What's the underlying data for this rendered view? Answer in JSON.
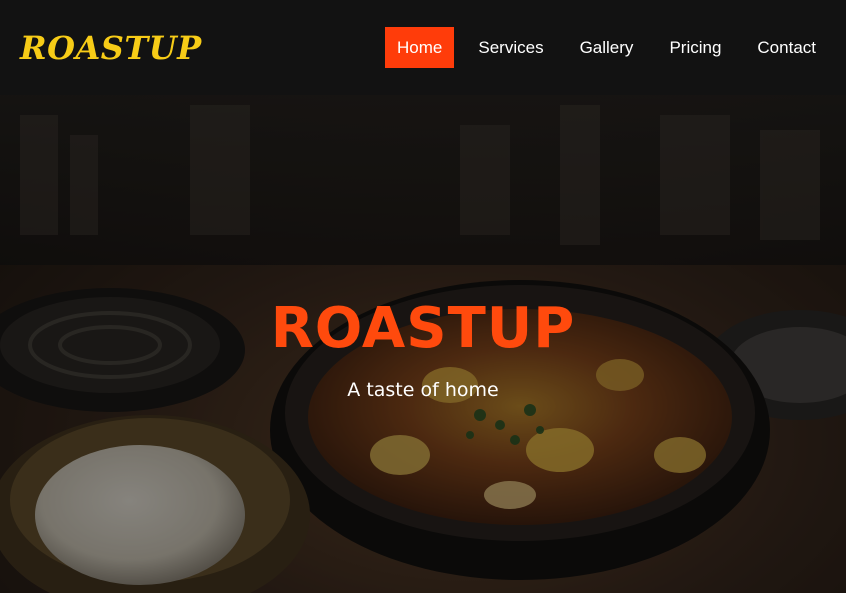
{
  "brand": {
    "logo_text": "ROASTUP",
    "logo_color": "#f7cc17"
  },
  "nav": {
    "items": [
      {
        "label": "Home",
        "active": true
      },
      {
        "label": "Services",
        "active": false
      },
      {
        "label": "Gallery",
        "active": false
      },
      {
        "label": "Pricing",
        "active": false
      },
      {
        "label": "Contact",
        "active": false
      }
    ],
    "active_color": "#ff3c0a"
  },
  "hero": {
    "title": "ROASTUP",
    "subtitle": "A taste of home",
    "title_color": "#ff4a0d",
    "background_image": "food-photo-bowl-of-stew-with-rice"
  }
}
